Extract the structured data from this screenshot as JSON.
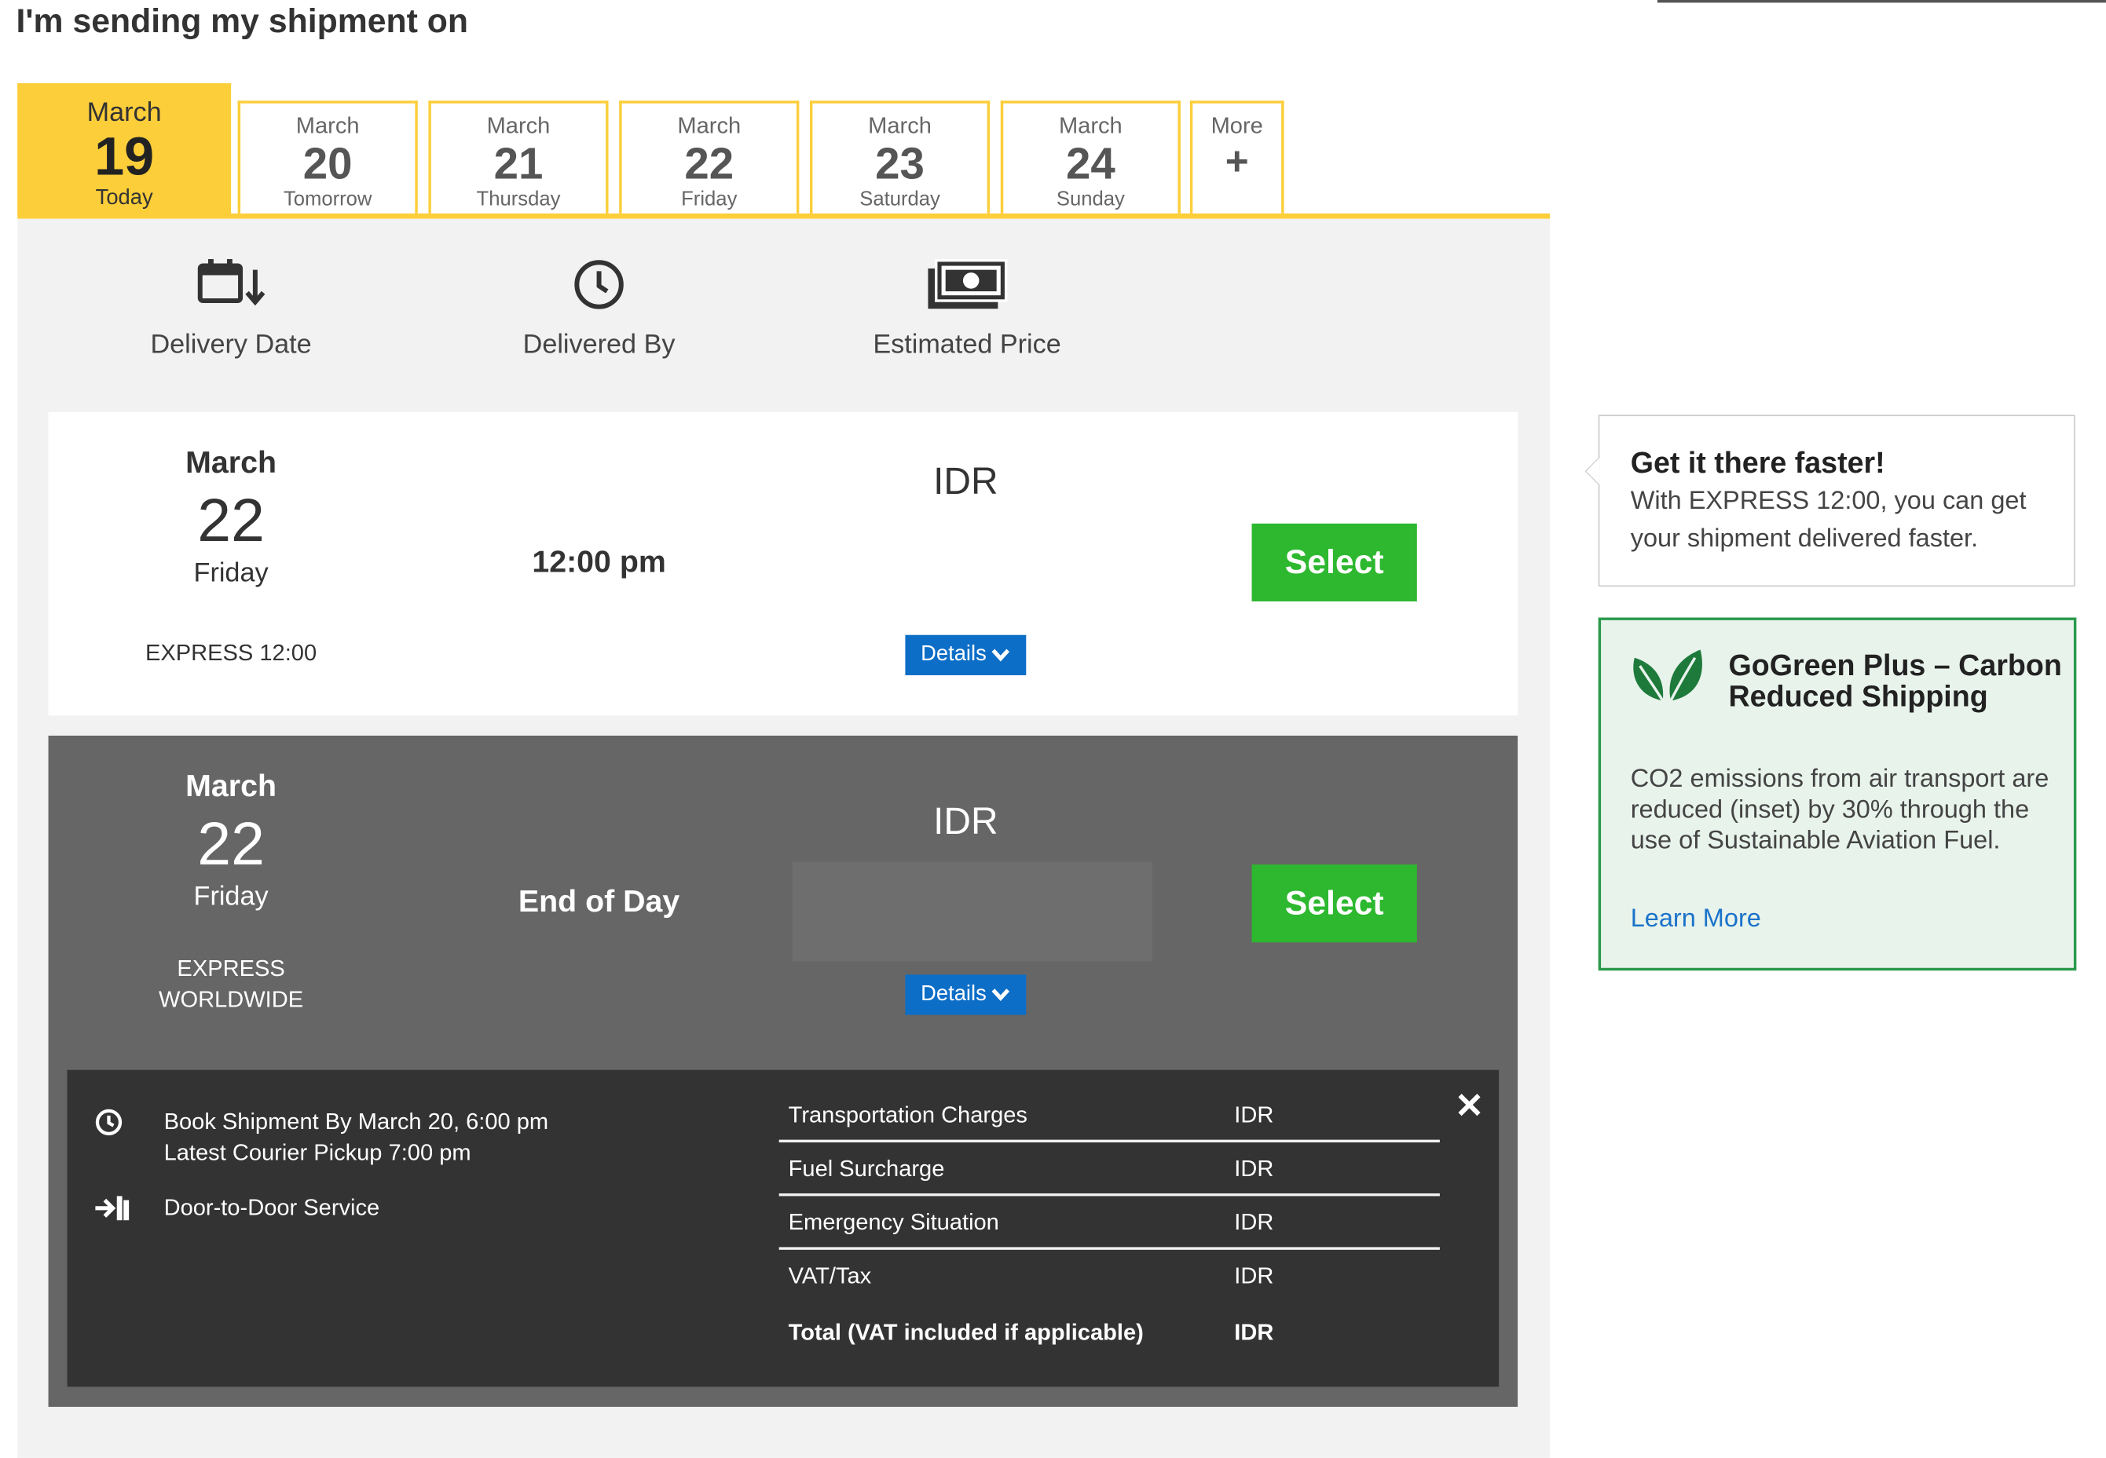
{
  "page_title": "I'm sending my shipment on",
  "date_tabs": [
    {
      "month": "March",
      "day": "19",
      "sub": "Today"
    },
    {
      "month": "March",
      "day": "20",
      "sub": "Tomorrow"
    },
    {
      "month": "March",
      "day": "21",
      "sub": "Thursday"
    },
    {
      "month": "March",
      "day": "22",
      "sub": "Friday"
    },
    {
      "month": "March",
      "day": "23",
      "sub": "Saturday"
    },
    {
      "month": "March",
      "day": "24",
      "sub": "Sunday"
    }
  ],
  "more_tab": {
    "label": "More",
    "symbol": "+"
  },
  "headers": {
    "delivery_date": "Delivery Date",
    "delivered_by": "Delivered By",
    "estimated_price": "Estimated Price"
  },
  "options": [
    {
      "month": "March",
      "day": "22",
      "weekday": "Friday",
      "product": "EXPRESS 12:00",
      "time": "12:00 pm",
      "currency": "IDR",
      "details_label": "Details",
      "select_label": "Select"
    },
    {
      "month": "March",
      "day": "22",
      "weekday": "Friday",
      "product_line1": "EXPRESS",
      "product_line2": "WORLDWIDE",
      "time": "End of Day",
      "currency": "IDR",
      "details_label": "Details",
      "select_label": "Select"
    }
  ],
  "details": {
    "book_by": "Book Shipment By March 20, 6:00 pm",
    "pickup": "Latest Courier Pickup 7:00 pm",
    "service": "Door-to-Door Service",
    "charges": [
      {
        "name": "Transportation Charges",
        "currency": "IDR"
      },
      {
        "name": "Fuel Surcharge",
        "currency": "IDR"
      },
      {
        "name": "Emergency Situation",
        "currency": "IDR"
      },
      {
        "name": "VAT/Tax",
        "currency": "IDR"
      },
      {
        "name": "Total (VAT included if applicable)",
        "currency": "IDR"
      }
    ]
  },
  "faster_card": {
    "title": "Get it there faster!",
    "body": "With EXPRESS 12:00, you can get your shipment delivered faster."
  },
  "gogreen_card": {
    "title": "GoGreen Plus – Carbon Reduced Shipping",
    "body": "CO2 emissions from air transport are reduced (inset) by 30% through the use of Sustainable Aviation Fuel.",
    "link": "Learn More"
  },
  "colors": {
    "accent_yellow": "#fcce3a",
    "select_green": "#2db82f",
    "details_blue": "#0d6ec7",
    "gogreen_border": "#2a9a4a",
    "link_blue": "#1a73c9"
  }
}
